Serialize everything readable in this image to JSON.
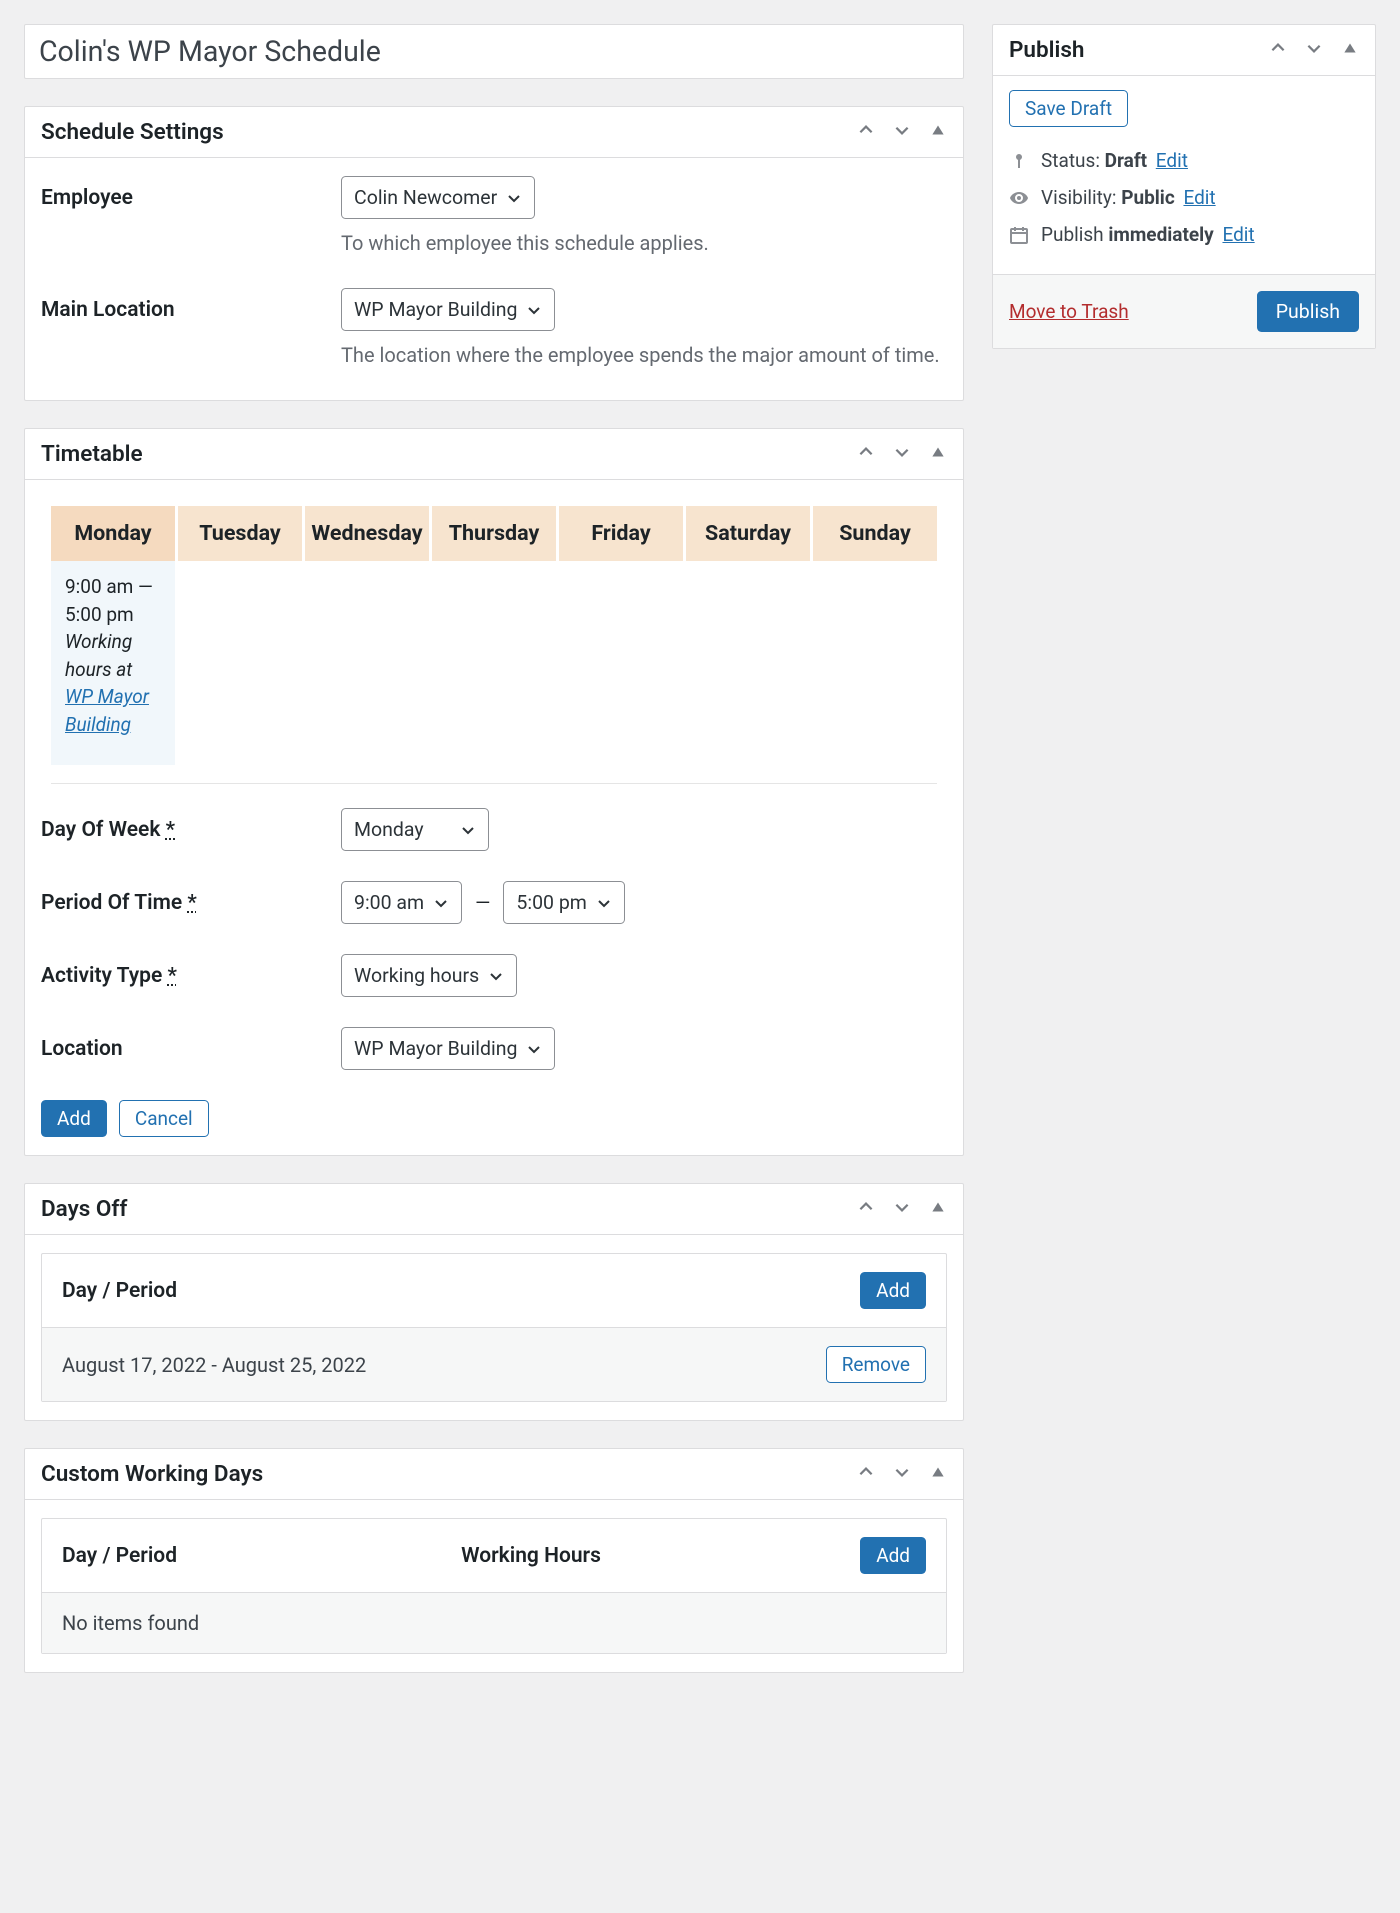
{
  "title": "Colin's WP Mayor Schedule",
  "scheduleSettings": {
    "heading": "Schedule Settings",
    "employeeLabel": "Employee",
    "employeeValue": "Colin Newcomer",
    "employeeDesc": "To which employee this schedule applies.",
    "locationLabel": "Main Location",
    "locationValue": "WP Mayor Building",
    "locationDesc": "The location where the employee spends the major amount of time."
  },
  "timetable": {
    "heading": "Timetable",
    "days": [
      "Monday",
      "Tuesday",
      "Wednesday",
      "Thursday",
      "Friday",
      "Saturday",
      "Sunday"
    ],
    "entry": {
      "time": "9:00 am — 5:00 pm",
      "activityLine": "Working hours at",
      "locationLink": "WP Mayor Building"
    },
    "form": {
      "dayLabel": "Day Of Week",
      "dayValue": "Monday",
      "periodLabel": "Period Of Time",
      "periodStart": "9:00 am",
      "periodEnd": "5:00 pm",
      "activityLabel": "Activity Type",
      "activityValue": "Working hours",
      "locationLabel": "Location",
      "locationValue": "WP Mayor Building",
      "addBtn": "Add",
      "cancelBtn": "Cancel",
      "required": "*"
    }
  },
  "daysOff": {
    "heading": "Days Off",
    "colLabel": "Day / Period",
    "addBtn": "Add",
    "rowValue": "August 17, 2022 - August 25, 2022",
    "removeBtn": "Remove"
  },
  "customDays": {
    "heading": "Custom Working Days",
    "col1": "Day / Period",
    "col2": "Working Hours",
    "addBtn": "Add",
    "empty": "No items found"
  },
  "publish": {
    "heading": "Publish",
    "saveDraft": "Save Draft",
    "statusLabel": "Status:",
    "statusValue": "Draft",
    "visibilityLabel": "Visibility:",
    "visibilityValue": "Public",
    "publishLabel": "Publish",
    "publishValue": "immediately",
    "editLink": "Edit",
    "trash": "Move to Trash",
    "publishBtn": "Publish"
  }
}
